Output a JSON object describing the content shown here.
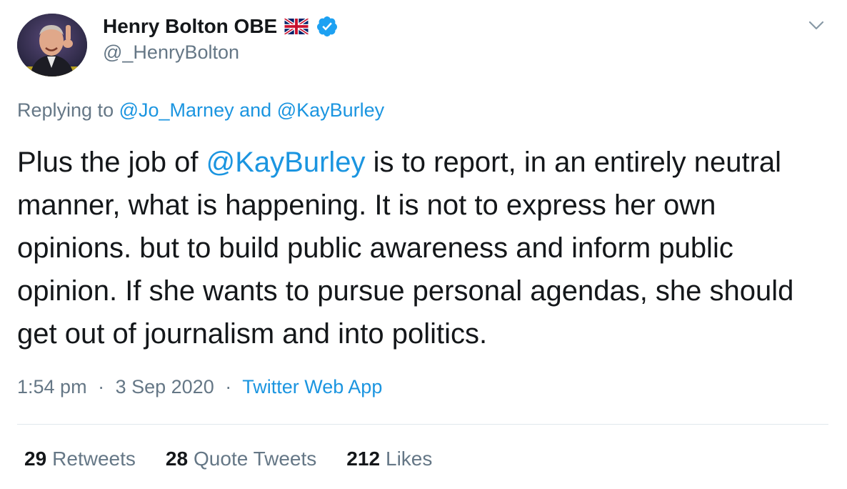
{
  "author": {
    "display_name": "Henry Bolton OBE",
    "handle": "@_HenryBolton",
    "avatar_icon": "profile-photo",
    "flag_icon": "uk-flag-icon",
    "verified_icon": "verified-badge-icon",
    "verified_color": "#1da1f2"
  },
  "reply": {
    "prefix": "Replying to",
    "user1": "@Jo_Marney",
    "connector": "and",
    "user2": "@KayBurley"
  },
  "body": {
    "before_mention": "Plus the job of ",
    "mention": "@KayBurley",
    "after_mention": " is to report, in an entirely neutral manner, what is happening. It is not to express her own opinions.  but to build public awareness and inform public opinion. If she wants to pursue personal agendas, she should get out of journalism and into politics."
  },
  "meta": {
    "time": "1:54 pm",
    "separator": "·",
    "date": "3 Sep 2020",
    "source": "Twitter Web App"
  },
  "stats": {
    "retweets_count": "29",
    "retweets_label": "Retweets",
    "quotes_count": "28",
    "quotes_label": "Quote Tweets",
    "likes_count": "212",
    "likes_label": "Likes"
  },
  "colors": {
    "link": "#1b95e0",
    "secondary_text": "#657786",
    "primary_text": "#14171a",
    "divider": "#e1e8ed"
  }
}
